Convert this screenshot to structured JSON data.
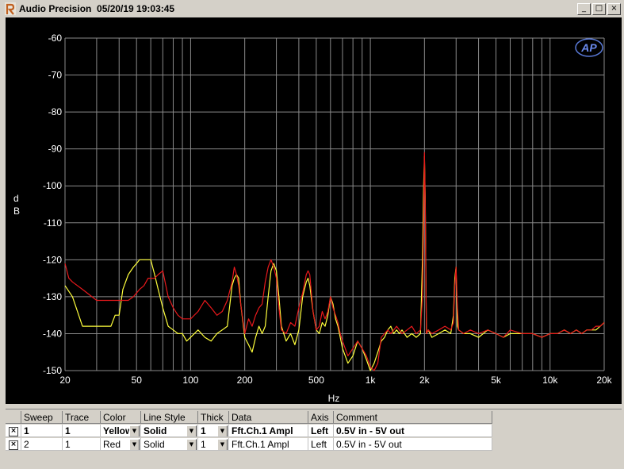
{
  "window": {
    "title": "Audio Precision  05/20/19 19:03:45",
    "minimize": "_",
    "maximize": "□",
    "close": "×"
  },
  "colors": {
    "yellow": "#ffff3c",
    "red": "#e8191c",
    "grid": "#8a8a8a",
    "background": "#000000"
  },
  "chart_data": {
    "type": "line",
    "title": "",
    "xlabel": "Hz",
    "ylabel": "d\nB",
    "x_scale": "log",
    "xlim": [
      20,
      20000
    ],
    "ylim": [
      -150,
      -60
    ],
    "x_ticks": [
      {
        "v": 20,
        "label": "20"
      },
      {
        "v": 50,
        "label": "50"
      },
      {
        "v": 100,
        "label": "100"
      },
      {
        "v": 200,
        "label": "200"
      },
      {
        "v": 500,
        "label": "500"
      },
      {
        "v": 1000,
        "label": "1k"
      },
      {
        "v": 2000,
        "label": "2k"
      },
      {
        "v": 5000,
        "label": "5k"
      },
      {
        "v": 10000,
        "label": "10k"
      },
      {
        "v": 20000,
        "label": "20k"
      }
    ],
    "y_ticks": [
      -60,
      -70,
      -80,
      -90,
      -100,
      -110,
      -120,
      -130,
      -140,
      -150
    ],
    "grid": true,
    "series": [
      {
        "name": "Fft.Ch.1 Ampl",
        "color": "#ffff3c",
        "x": [
          20,
          22,
          25,
          27,
          30,
          33,
          36,
          38,
          40,
          42,
          45,
          48,
          50,
          52,
          55,
          58,
          60,
          63,
          66,
          70,
          75,
          80,
          85,
          90,
          95,
          100,
          110,
          120,
          130,
          140,
          150,
          160,
          170,
          175,
          180,
          185,
          190,
          200,
          210,
          220,
          230,
          240,
          250,
          260,
          270,
          280,
          290,
          300,
          310,
          320,
          340,
          360,
          380,
          400,
          420,
          440,
          450,
          460,
          480,
          500,
          520,
          540,
          560,
          580,
          600,
          620,
          640,
          660,
          680,
          700,
          750,
          800,
          850,
          900,
          950,
          1000,
          1050,
          1100,
          1150,
          1200,
          1250,
          1300,
          1350,
          1400,
          1450,
          1500,
          1600,
          1700,
          1800,
          1900,
          1950,
          1980,
          2000,
          2020,
          2050,
          2100,
          2200,
          2400,
          2600,
          2800,
          2900,
          2950,
          3000,
          3050,
          3100,
          3300,
          3600,
          4000,
          4500,
          5000,
          5500,
          6000,
          7000,
          8000,
          9000,
          10000,
          11000,
          12000,
          13000,
          14000,
          15000,
          16000,
          17000,
          18000,
          19000,
          20000
        ],
        "values": [
          -127,
          -130,
          -138,
          -138,
          -138,
          -138,
          -138,
          -135,
          -135,
          -128,
          -124,
          -122,
          -121,
          -120,
          -120,
          -120,
          -120,
          -124,
          -128,
          -133,
          -138,
          -139,
          -140,
          -140,
          -142,
          -141,
          -139,
          -141,
          -142,
          -140,
          -139,
          -138,
          -127,
          -125,
          -124,
          -125,
          -132,
          -141,
          -143,
          -145,
          -141,
          -138,
          -140,
          -138,
          -130,
          -123,
          -121,
          -123,
          -130,
          -138,
          -142,
          -140,
          -143,
          -139,
          -130,
          -126,
          -125,
          -127,
          -134,
          -139,
          -140,
          -137,
          -138,
          -135,
          -130,
          -132,
          -136,
          -138,
          -141,
          -144,
          -148,
          -146,
          -142,
          -144,
          -147,
          -150,
          -148,
          -145,
          -142,
          -141,
          -139,
          -138,
          -140,
          -139,
          -140,
          -139,
          -141,
          -140,
          -141,
          -140,
          -120,
          -100,
          -92,
          -103,
          -140,
          -139,
          -141,
          -140,
          -139,
          -140,
          -135,
          -125,
          -122,
          -138,
          -139,
          -140,
          -140,
          -141,
          -139,
          -140,
          -141,
          -140,
          -140,
          -140,
          -141,
          -140,
          -140,
          -139,
          -140,
          -139,
          -140,
          -139,
          -139,
          -139,
          -138,
          -137
        ]
      },
      {
        "name": "Fft.Ch.1 Ampl",
        "color": "#e8191c",
        "x": [
          20,
          21,
          22,
          25,
          30,
          35,
          40,
          45,
          48,
          50,
          52,
          55,
          58,
          60,
          63,
          66,
          70,
          75,
          80,
          85,
          90,
          95,
          100,
          110,
          120,
          130,
          140,
          150,
          160,
          170,
          175,
          180,
          185,
          190,
          200,
          210,
          220,
          230,
          240,
          250,
          260,
          270,
          280,
          290,
          300,
          310,
          320,
          340,
          360,
          380,
          400,
          420,
          440,
          450,
          460,
          480,
          500,
          520,
          540,
          560,
          580,
          600,
          620,
          640,
          660,
          680,
          700,
          750,
          800,
          850,
          900,
          950,
          1000,
          1050,
          1100,
          1150,
          1200,
          1250,
          1300,
          1350,
          1400,
          1450,
          1500,
          1600,
          1700,
          1800,
          1900,
          1950,
          1980,
          2000,
          2020,
          2050,
          2100,
          2200,
          2400,
          2600,
          2800,
          2900,
          2950,
          3000,
          3050,
          3100,
          3300,
          3600,
          4000,
          4500,
          5000,
          5500,
          6000,
          7000,
          8000,
          9000,
          10000,
          11000,
          12000,
          13000,
          14000,
          15000,
          16000,
          17000,
          18000,
          19000,
          20000
        ],
        "values": [
          -121,
          -125,
          -126,
          -128,
          -131,
          -131,
          -131,
          -131,
          -130,
          -129,
          -128,
          -127,
          -125,
          -125,
          -125,
          -124,
          -123,
          -130,
          -133,
          -135,
          -136,
          -136,
          -136,
          -134,
          -131,
          -133,
          -135,
          -134,
          -131,
          -126,
          -122,
          -124,
          -127,
          -132,
          -140,
          -136,
          -138,
          -135,
          -133,
          -132,
          -126,
          -122,
          -120,
          -122,
          -125,
          -133,
          -139,
          -140,
          -137,
          -138,
          -133,
          -129,
          -124,
          -123,
          -124,
          -134,
          -139,
          -138,
          -134,
          -136,
          -134,
          -130,
          -133,
          -135,
          -137,
          -140,
          -142,
          -146,
          -144,
          -142,
          -144,
          -146,
          -149,
          -150,
          -148,
          -141,
          -140,
          -139,
          -140,
          -139,
          -138,
          -139,
          -140,
          -139,
          -138,
          -140,
          -139,
          -130,
          -110,
          -91,
          -105,
          -140,
          -139,
          -140,
          -139,
          -138,
          -139,
          -137,
          -127,
          -122,
          -133,
          -139,
          -140,
          -139,
          -140,
          -139,
          -140,
          -141,
          -139,
          -140,
          -140,
          -141,
          -140,
          -140,
          -139,
          -140,
          -139,
          -140,
          -139,
          -139,
          -138,
          -138,
          -137
        ]
      }
    ]
  },
  "legend": {
    "columns": [
      "Sweep",
      "Trace",
      "Color",
      "Line Style",
      "Thick",
      "Data",
      "Axis",
      "Comment"
    ],
    "rows": [
      {
        "sweep": "1",
        "trace": "1",
        "color": "Yellow",
        "style": "Solid",
        "thick": "1",
        "data": "Fft.Ch.1 Ampl",
        "axis": "Left",
        "comment": "0.5V in - 5V out"
      },
      {
        "sweep": "2",
        "trace": "1",
        "color": "Red",
        "style": "Solid",
        "thick": "1",
        "data": "Fft.Ch.1 Ampl",
        "axis": "Left",
        "comment": "0.5V in - 5V out"
      }
    ]
  },
  "brand": {
    "logo_text": "AP"
  }
}
